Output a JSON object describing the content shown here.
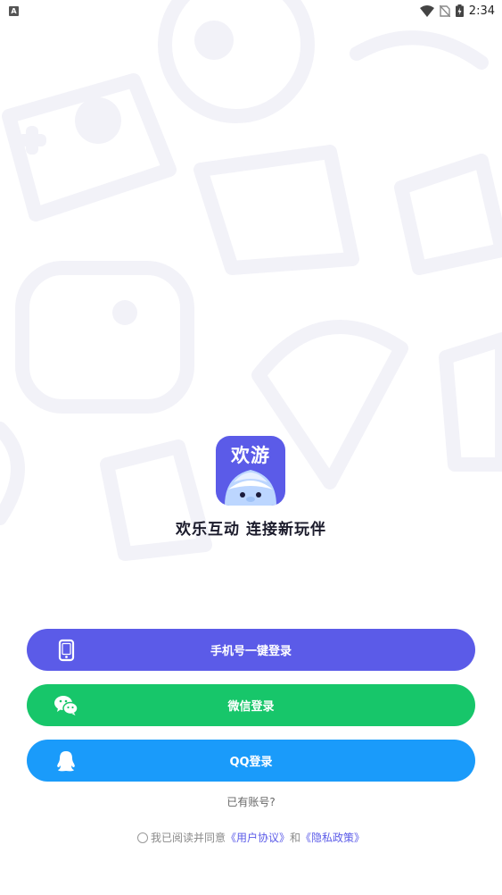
{
  "status_bar": {
    "notification_icon": "A",
    "time": "2:34",
    "icons": [
      "wifi-icon",
      "no-sim-icon",
      "battery-charging-icon"
    ]
  },
  "logo": {
    "text": "欢游",
    "brand_color": "#5b5be8"
  },
  "slogan": "欢乐互动 连接新玩伴",
  "buttons": {
    "phone_login": {
      "label": "手机号一键登录",
      "icon": "phone-icon",
      "color": "#5b5be8"
    },
    "wechat_login": {
      "label": "微信登录",
      "icon": "wechat-icon",
      "color": "#17c66a"
    },
    "qq_login": {
      "label": "QQ登录",
      "icon": "qq-icon",
      "color": "#1a9bfa"
    }
  },
  "has_account": "已有账号?",
  "agreement": {
    "prefix": "我已阅读并同意",
    "user_agreement": "《用户协议》",
    "conjunction": "和",
    "privacy_policy": "《隐私政策》",
    "link_color": "#5b5be8"
  }
}
